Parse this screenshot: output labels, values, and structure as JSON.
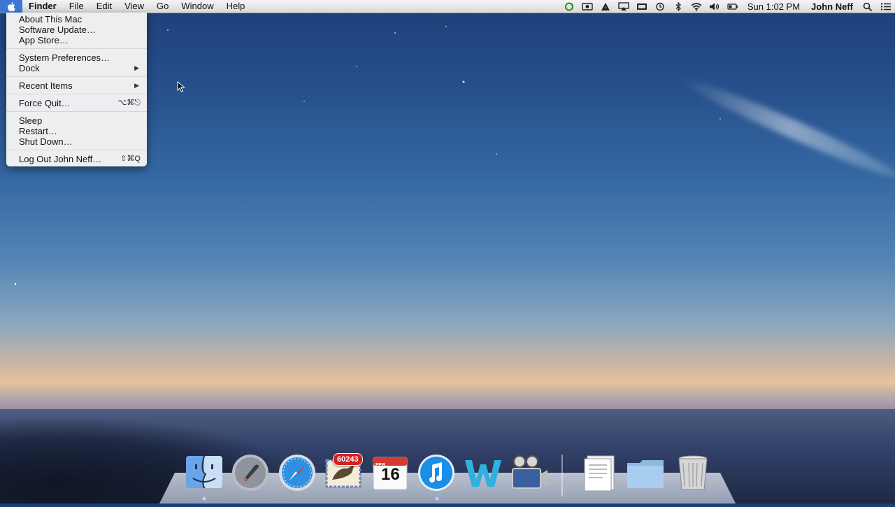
{
  "menubar": {
    "apple_icon": "apple-logo-icon",
    "menus": [
      "Finder",
      "File",
      "Edit",
      "View",
      "Go",
      "Window",
      "Help"
    ],
    "status_icons": [
      "sync-icon",
      "camera-icon",
      "adobe-icon",
      "airplay-icon",
      "battery-menu-icon",
      "time-machine-icon",
      "bluetooth-icon",
      "wifi-icon",
      "volume-icon",
      "battery-icon"
    ],
    "clock": "Sun 1:02 PM",
    "user": "John Neff",
    "spotlight_icon": "search-icon",
    "notification_icon": "list-icon"
  },
  "apple_menu": {
    "items": [
      {
        "label": "About This Mac",
        "shortcut": ""
      },
      {
        "label": "Software Update…",
        "shortcut": ""
      },
      {
        "label": "App Store…",
        "shortcut": ""
      },
      {
        "label": "System Preferences…",
        "shortcut": ""
      },
      {
        "label": "Dock",
        "shortcut": "▶"
      },
      {
        "label": "Recent Items",
        "shortcut": "▶"
      },
      {
        "label": "Force Quit…",
        "shortcut": "⌥⌘⎋"
      },
      {
        "label": "Sleep",
        "shortcut": ""
      },
      {
        "label": "Restart…",
        "shortcut": ""
      },
      {
        "label": "Shut Down…",
        "shortcut": ""
      },
      {
        "label": "Log Out John Neff…",
        "shortcut": "⇧⌘Q"
      }
    ]
  },
  "dock": {
    "items": [
      "finder-icon",
      "launchpad-icon",
      "safari-icon",
      "mail-icon",
      "calendar-icon",
      "itunes-icon",
      "word-icon",
      "video-app-icon",
      "document-stack-icon",
      "folder-stack-icon",
      "trash-icon"
    ],
    "mail_badge": "60243",
    "calendar_month": "FEB",
    "calendar_day": "16"
  },
  "colors": {
    "accent": "#3d78d6",
    "menubar": "#e6e6e6",
    "badge": "#d42020"
  }
}
